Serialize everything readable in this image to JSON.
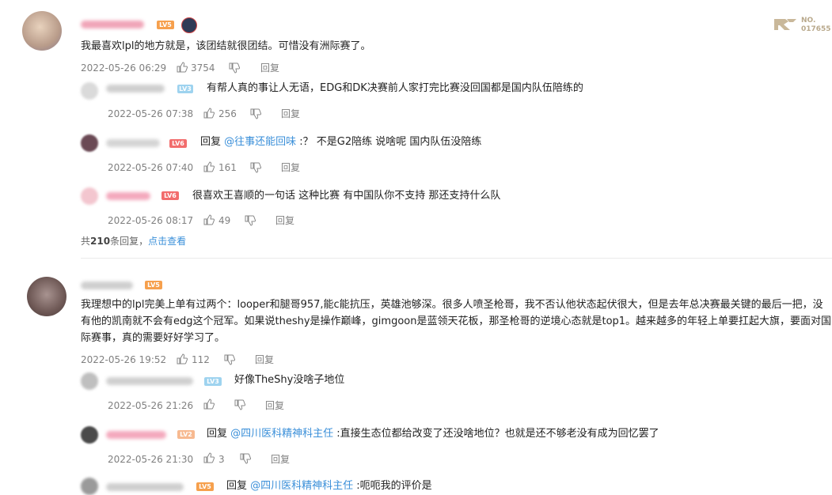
{
  "watermark": {
    "line1": "NO.",
    "line2": "017655"
  },
  "comment1": {
    "level_badge": "LV5",
    "text": "我最喜欢lpl的地方就是，该团结就很团结。可惜没有洲际赛了。",
    "time": "2022-05-26 06:29",
    "likes": "3754",
    "reply_label": "回复"
  },
  "reply1": {
    "level_badge": "LV3",
    "text": "有帮人真的事让人无语，EDG和DK决赛前人家打完比赛没回国都是国内队伍陪练的",
    "time": "2022-05-26 07:38",
    "likes": "256",
    "reply_label": "回复"
  },
  "reply2": {
    "level_badge": "LV6",
    "prefix": "回复 ",
    "mention": "@往事还能回味",
    "text": " :？ 不是G2陪练 说啥呢 国内队伍没陪练",
    "time": "2022-05-26 07:40",
    "likes": "161",
    "reply_label": "回复"
  },
  "reply3": {
    "level_badge": "LV6",
    "text": "很喜欢王喜顺的一句话 这种比赛 有中国队你不支持 那还支持什么队",
    "time": "2022-05-26 08:17",
    "likes": "49",
    "reply_label": "回复"
  },
  "summary": {
    "prefix": "共",
    "count": "210",
    "suffix": "条回复，",
    "link": "点击查看"
  },
  "comment2": {
    "level_badge": "LV5",
    "text": "我理想中的lpl完美上单有过两个：looper和腿哥957,能c能抗压，英雄池够深。很多人喷圣枪哥，我不否认他状态起伏很大，但是去年总决赛最关键的最后一把，没有他的凯南就不会有edg这个冠军。如果说theshy是操作巅峰，gimgoon是蓝领天花板，那圣枪哥的逆境心态就是top1。越来越多的年轻上单要扛起大旗，要面对国际赛事，真的需要好好学习了。",
    "time": "2022-05-26 19:52",
    "likes": "112",
    "reply_label": "回复"
  },
  "reply4": {
    "level_badge": "LV3",
    "text": "好像TheShy没啥子地位",
    "time": "2022-05-26 21:26",
    "likes": "",
    "reply_label": "回复"
  },
  "reply5": {
    "level_badge": "LV2",
    "prefix": "回复 ",
    "mention": "@四川医科精神科主任",
    "text": " :直接生态位都给改变了还没啥地位？也就是还不够老没有成为回忆罢了",
    "time": "2022-05-26 21:30",
    "likes": "3",
    "reply_label": "回复"
  },
  "reply6": {
    "level_badge": "LV5",
    "prefix": "回复 ",
    "mention": "@四川医科精神科主任",
    "text": " :呃呃我的评价是"
  }
}
